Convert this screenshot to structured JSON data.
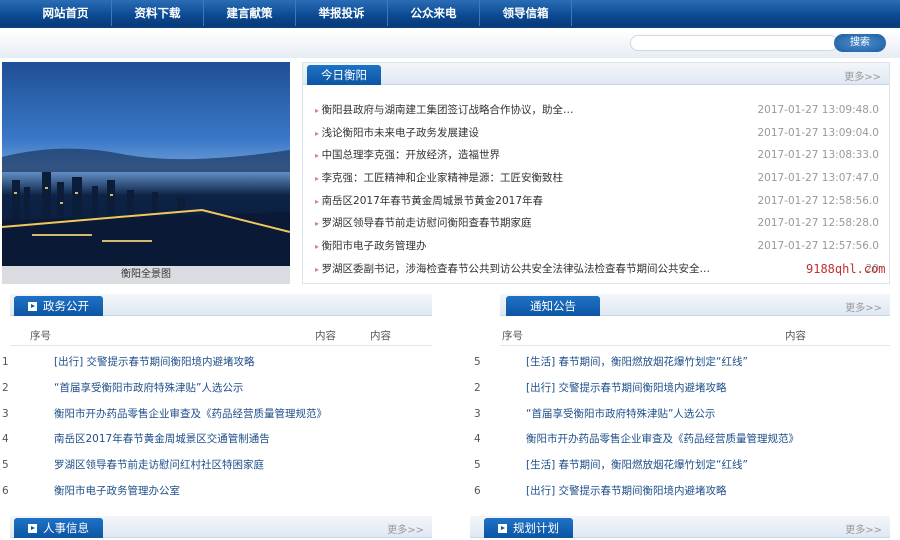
{
  "nav": [
    "网站首页",
    "资料下载",
    "建言献策",
    "举报投诉",
    "公众来电",
    "领导信箱"
  ],
  "search": {
    "button": "搜索",
    "placeholder": ""
  },
  "photo": {
    "caption": "衡阳全景图"
  },
  "today": {
    "title": "今日衡阳",
    "more": "更多>>",
    "items": [
      {
        "title": "衡阳县政府与湖南建工集团签订战略合作协议，助全…",
        "date": "2017-01-27 13:09:48.0"
      },
      {
        "title": "浅论衡阳市未来电子政务发展建设",
        "date": "2017-01-27 13:09:04.0"
      },
      {
        "title": "中国总理李克强：开放经济，造福世界",
        "date": "2017-01-27 13:08:33.0"
      },
      {
        "title": "李克强：工匠精神和企业家精神是源：工匠安衡致柱",
        "date": "2017-01-27 13:07:47.0"
      },
      {
        "title": "南岳区2017年春节黄金周城景节黄金2017年春",
        "date": "2017-01-27 12:58:56.0"
      },
      {
        "title": "罗湖区领导春节前走访慰问衡阳查春节期家庭",
        "date": "2017-01-27 12:58:28.0"
      },
      {
        "title": "衡阳市电子政务管理办",
        "date": "2017-01-27 12:57:56.0"
      },
      {
        "title": "罗湖区委副书记，涉海检查春节公共到访公共安全法律弘法检查春节期间公共安全…",
        "date": "20"
      }
    ]
  },
  "gov": {
    "title": "政务公开",
    "col_no": "序号",
    "col_content": "内容",
    "col_content2": "内容",
    "rows": [
      {
        "no": "1",
        "text": "[出行] 交警提示春节期间衡阳境内避堵攻略"
      },
      {
        "no": "2",
        "text": "“首届享受衡阳市政府特殊津贴”人选公示"
      },
      {
        "no": "3",
        "text": "衡阳市开办药品零售企业审查及《药品经营质量管理规范》"
      },
      {
        "no": "4",
        "text": "南岳区2017年春节黄金周城景区交通管制通告"
      },
      {
        "no": "5",
        "text": "罗湖区领导春节前走访慰问红村社区特困家庭"
      },
      {
        "no": "6",
        "text": "衡阳市电子政务管理办公室"
      }
    ]
  },
  "notice": {
    "title": "通知公告",
    "more": "更多>>",
    "col_no": "序号",
    "col_content": "内容",
    "rows": [
      {
        "no": "5",
        "text": "[生活] 春节期间，衡阳燃放烟花爆竹划定“红线”"
      },
      {
        "no": "2",
        "text": "[出行] 交警提示春节期间衡阳境内避堵攻略"
      },
      {
        "no": "3",
        "text": "“首届享受衡阳市政府特殊津贴”人选公示"
      },
      {
        "no": "4",
        "text": "衡阳市开办药品零售企业审查及《药品经营质量管理规范》"
      },
      {
        "no": "5",
        "text": "[生活] 春节期间，衡阳燃放烟花爆竹划定“红线”"
      },
      {
        "no": "6",
        "text": "[出行] 交警提示春节期间衡阳境内避堵攻略"
      }
    ]
  },
  "personnel": {
    "title": "人事信息",
    "more": "更多>>"
  },
  "planning": {
    "title": "规划计划",
    "more": "更多>>"
  },
  "watermark": "9188qhl.com"
}
